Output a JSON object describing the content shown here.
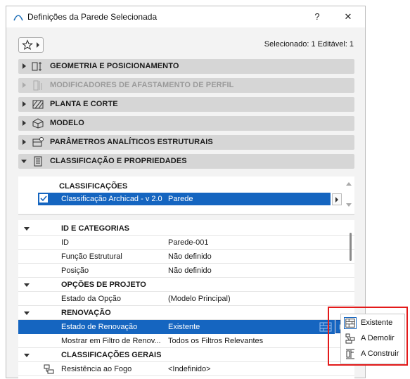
{
  "window": {
    "title": "Definições da Parede Selecionada",
    "help_label": "?",
    "close_label": "✕"
  },
  "toolbar": {
    "favorites_icon": "star-outline-icon",
    "selection_info": "Selecionado: 1 Editável: 1"
  },
  "panels": [
    {
      "label": "GEOMETRIA E POSICIONAMENTO",
      "expanded": false,
      "enabled": true
    },
    {
      "label": "MODIFICADORES DE AFASTAMENTO DE PERFIL",
      "expanded": false,
      "enabled": false
    },
    {
      "label": "PLANTA E CORTE",
      "expanded": false,
      "enabled": true
    },
    {
      "label": "MODELO",
      "expanded": false,
      "enabled": true
    },
    {
      "label": "PARÂMETROS ANALÍTICOS ESTRUTURAIS",
      "expanded": false,
      "enabled": true
    },
    {
      "label": "CLASSIFICAÇÃO E PROPRIEDADES",
      "expanded": true,
      "enabled": true
    }
  ],
  "classifications": {
    "title": "CLASSIFICAÇÕES",
    "row": {
      "name": "Classificação Archicad - v 2.0",
      "value": "Parede",
      "checked": true
    }
  },
  "properties": {
    "groups": [
      {
        "title": "ID E CATEGORIAS",
        "rows": [
          {
            "key": "ID",
            "value": "Parede-001"
          },
          {
            "key": "Função Estrutural",
            "value": "Não definido"
          },
          {
            "key": "Posição",
            "value": "Não definido"
          }
        ]
      },
      {
        "title": "OPÇÕES DE PROJETO",
        "rows": [
          {
            "key": "Estado da Opção",
            "value": "(Modelo Principal)"
          }
        ]
      },
      {
        "title": "RENOVAÇÃO",
        "rows": [
          {
            "key": "Estado de Renovação",
            "value": "Existente",
            "selected": true
          },
          {
            "key": "Mostrar em Filtro de Renov...",
            "value": "Todos os Filtros Relevantes"
          }
        ]
      },
      {
        "title": "CLASSIFICAÇÕES GERAIS",
        "rows": [
          {
            "key": "Resistência ao Fogo",
            "value": "<Indefinido>"
          }
        ]
      }
    ]
  },
  "renovation_popup": {
    "items": [
      {
        "label": "Existente",
        "icon": "existing-wall-icon"
      },
      {
        "label": "A Demolir",
        "icon": "demolish-icon"
      },
      {
        "label": "A Construir",
        "icon": "new-construction-icon"
      }
    ],
    "highlight_color": "#e31a1a",
    "selection_color": "#1565c0"
  }
}
